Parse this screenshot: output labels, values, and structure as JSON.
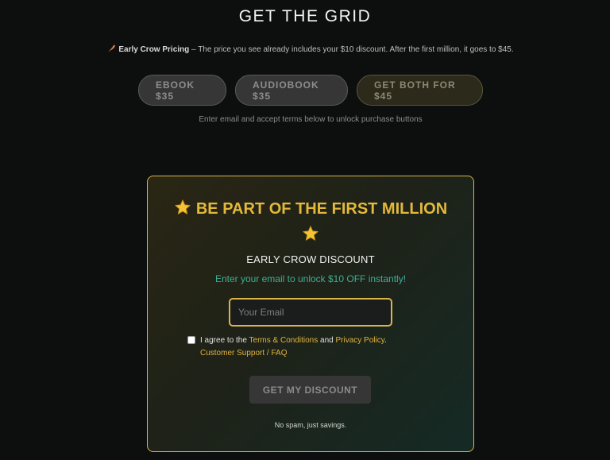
{
  "header": {
    "title": "GET THE GRID"
  },
  "pricing_note": {
    "icon": "feather-icon",
    "bold_label": "Early Crow Pricing",
    "text": " – The price you see already includes your $10 discount. After the first million, it goes to $45."
  },
  "purchase_buttons": {
    "ebook_label": "EBOOK $35",
    "audiobook_label": "AUDIOBOOK $35",
    "both_label": "GET BOTH FOR $45"
  },
  "unlock_note": "Enter email and accept terms below to unlock purchase buttons",
  "promo": {
    "title": "BE PART OF THE FIRST MILLION",
    "star_icon": "star-icon",
    "subtitle": "EARLY CROW DISCOUNT",
    "hint": "Enter your email to unlock $10 OFF instantly!",
    "email_placeholder": "Your Email",
    "email_value": "",
    "terms_prefix": "I agree to the ",
    "terms_link": "Terms & Conditions",
    "terms_and": " and ",
    "privacy_link": "Privacy Policy",
    "terms_suffix": ".",
    "terms_checked": false,
    "support_link": "Customer Support / FAQ",
    "button_label": "GET MY DISCOUNT",
    "footer_note": "No spam, just savings."
  },
  "colors": {
    "background": "#0d0e0e",
    "accent_gold": "#e2b93a",
    "accent_teal": "#3fae94",
    "disabled_button": "#363636"
  }
}
